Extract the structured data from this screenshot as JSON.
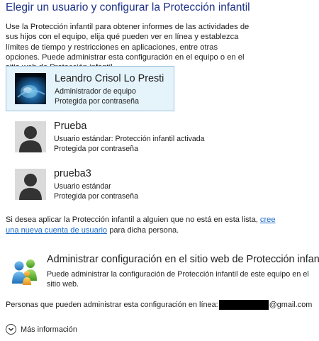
{
  "header": {
    "title": "Elegir un usuario y configurar la Protección infantil"
  },
  "intro": "Use la Protección infantil para obtener informes de las actividades de sus hijos con el equipo, elija qué pueden ver en línea y establezca límites de tiempo y restricciones en aplicaciones, entre otras opciones. Puede administrar esta configuración en el equipo o en el sitio web de Protección infantil.",
  "users": [
    {
      "name": "Leandro Crisol Lo Presti",
      "type": "Administrador de equipo",
      "protection": "Protegida por contraseña",
      "selected": true,
      "avatar": "photo-avatar"
    },
    {
      "name": "Prueba",
      "type": "Usuario estándar: Protección infantil activada",
      "protection": "Protegida por contraseña",
      "selected": false,
      "avatar": "default-user-icon"
    },
    {
      "name": "prueba3",
      "type": "Usuario estándar",
      "protection": "Protegida por contraseña",
      "selected": false,
      "avatar": "default-user-icon"
    }
  ],
  "add_account": {
    "prefix": "Si desea aplicar la Protección infantil a alguien que no está en esta lista, ",
    "link": "cree una nueva cuenta de usuario",
    "suffix": " para dicha persona."
  },
  "web_settings": {
    "title": "Administrar configuración en el sitio web de Protección infantil",
    "description": "Puede administrar la configuración de Protección infantil de este equipo en el sitio web.",
    "icon": "family-safety-icon"
  },
  "admins": {
    "label": "Personas que pueden administrar esta configuración en línea:",
    "email_suffix": "@gmail.com"
  },
  "more_info": {
    "label": "Más información",
    "icon": "chevron-down-icon"
  },
  "colors": {
    "title": "#1e3287",
    "link": "#1b6ac9",
    "selected_bg": "#e5f3fb",
    "selected_border": "#9fc3df"
  }
}
